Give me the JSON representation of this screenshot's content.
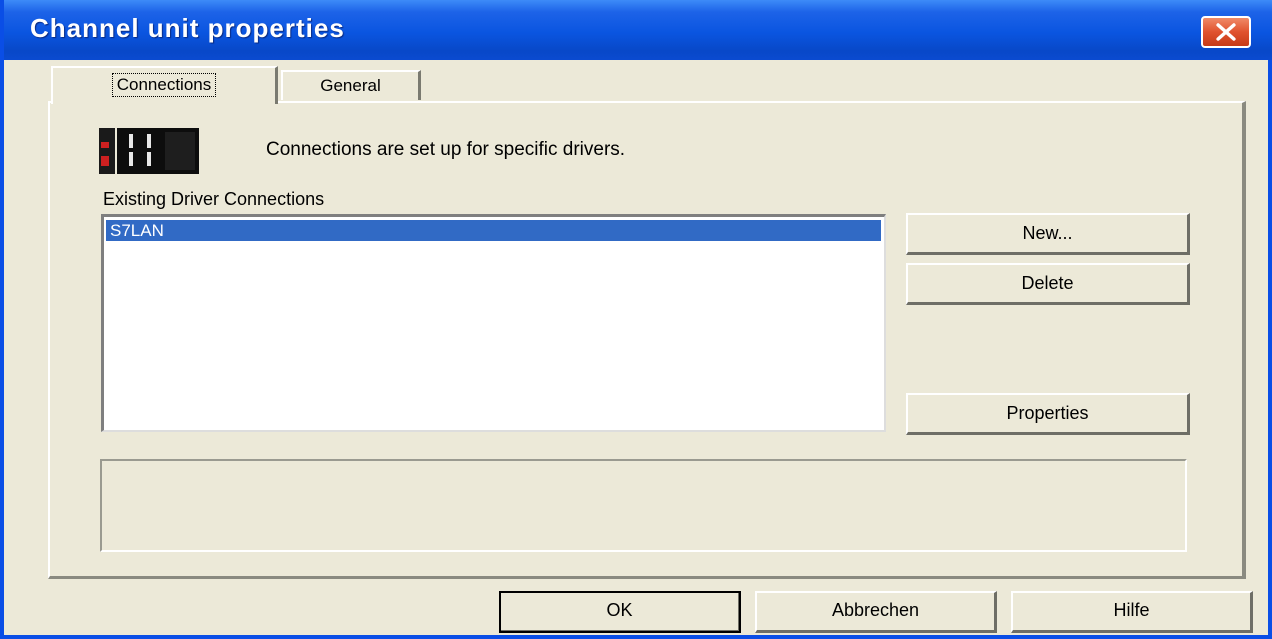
{
  "window": {
    "title": "Channel unit properties"
  },
  "tabs": [
    {
      "label": "Connections",
      "active": true
    },
    {
      "label": "General",
      "active": false
    }
  ],
  "panel": {
    "info_text": "Connections are set up for specific drivers.",
    "list_label": "Existing Driver Connections",
    "list_items": [
      "S7LAN"
    ],
    "selected_item": "S7LAN",
    "buttons": {
      "new": "New...",
      "delete": "Delete",
      "properties": "Properties"
    }
  },
  "footer": {
    "ok": "OK",
    "cancel": "Abbrechen",
    "help": "Hilfe"
  },
  "colors": {
    "titlebar": "#0a55e0",
    "face": "#ece9d8",
    "selection": "#316ac5",
    "close_button": "#e0522e"
  },
  "icons": {
    "close": "close-icon",
    "driver": "driver-connection-icon"
  }
}
